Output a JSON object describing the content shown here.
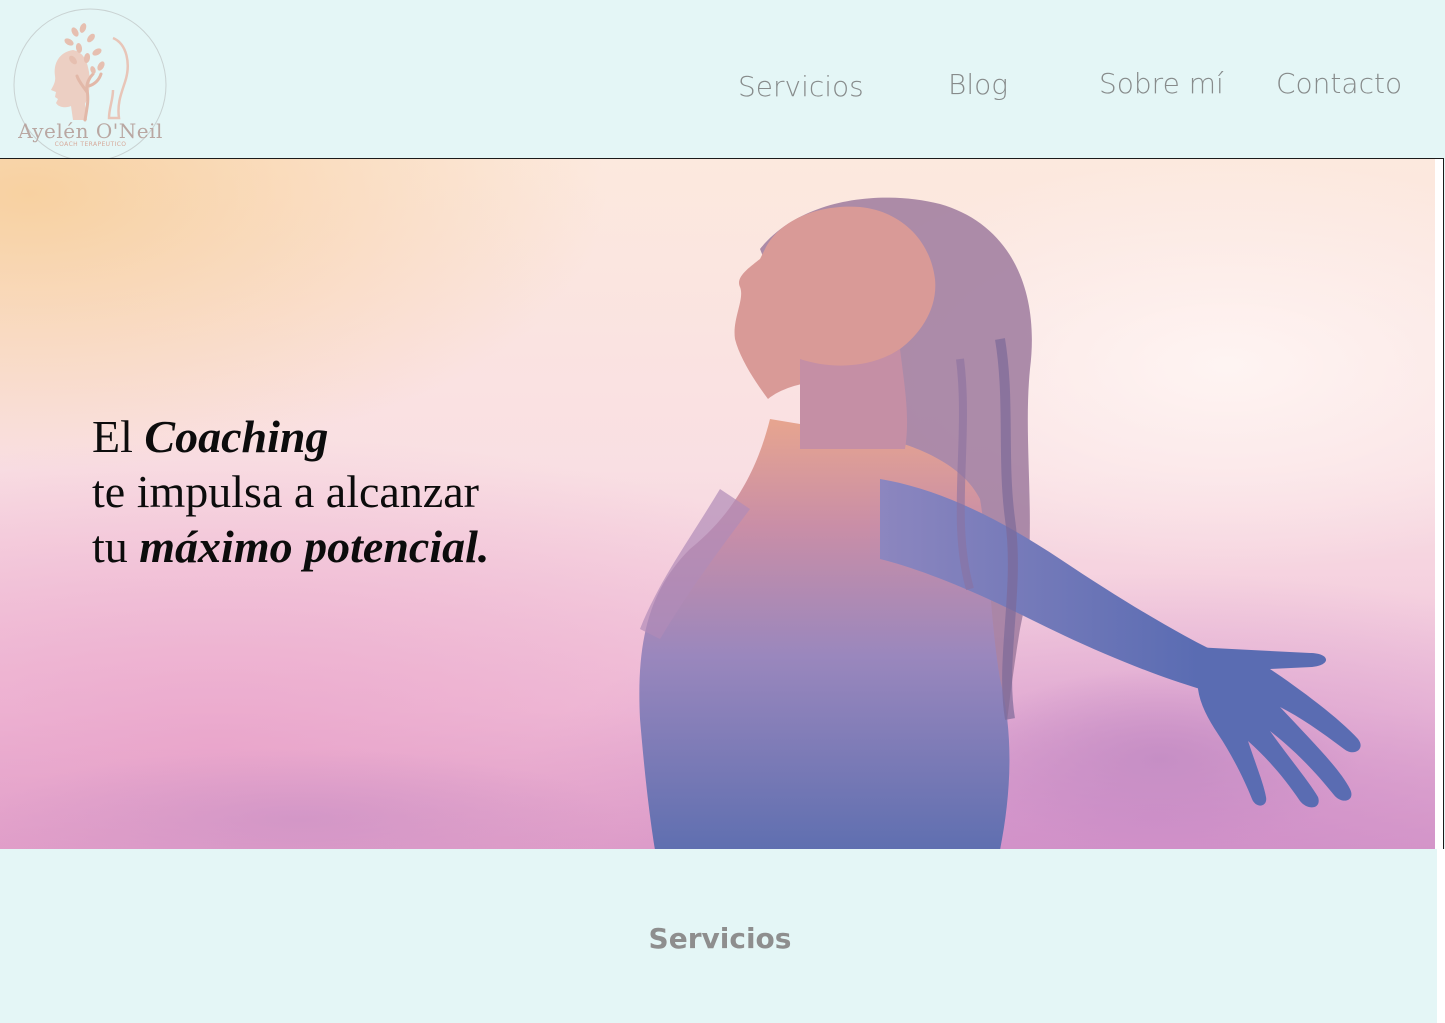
{
  "brand": {
    "name": "Ayelén O'Neil",
    "tagline": "COACH TERAPEUTICO",
    "logo_icon": "profile-tree-icon",
    "colors": {
      "background": "#e4f6f6",
      "nav_text": "#878b8b",
      "logo_accent": "#e8c5b8"
    }
  },
  "nav": {
    "items": [
      {
        "label": "Servicios"
      },
      {
        "label": "Blog"
      },
      {
        "label": "Sobre mí"
      },
      {
        "label": "Contacto"
      }
    ]
  },
  "hero": {
    "line1_prefix": "El ",
    "line1_emphasis": "Coaching",
    "line2": "te impulsa a alcanzar",
    "line3_prefix": "tu ",
    "line3_emphasis": "máximo potencial."
  },
  "services": {
    "title": "Servicios"
  }
}
